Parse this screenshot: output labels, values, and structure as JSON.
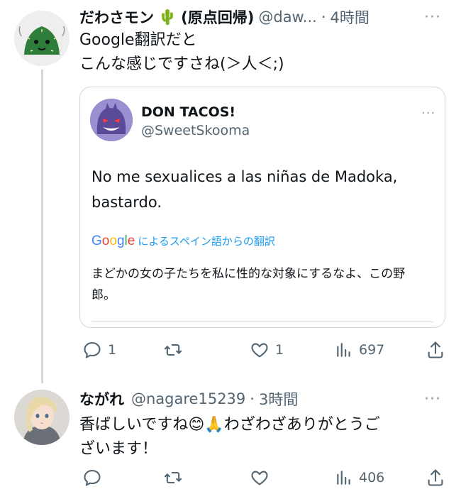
{
  "tweet1": {
    "display_name": "だわさモン",
    "name_emoji": "🌵",
    "name_suffix": "(原点回帰)",
    "handle": "@daw...",
    "separator": "·",
    "time": "4時間",
    "text_line1": "Google翻訳だと",
    "text_line2": "こんな感じですさね(＞人＜;)",
    "actions": {
      "replies": "1",
      "likes": "1",
      "views": "697"
    }
  },
  "quote": {
    "display_name": "DON TACOS!",
    "handle": "@SweetSkooma",
    "text_line1": "No me sexualices a las niñas de Madoka,",
    "text_line2": "bastardo.",
    "translation_logo": "Google",
    "translation_label": "によるスペイン語からの翻訳",
    "translation_line1": "まどかの女の子たちを私に性的な対象にするなよ、この野",
    "translation_line2": "郎。"
  },
  "tweet2": {
    "display_name": "ながれ",
    "handle": "@nagare15239",
    "separator": "·",
    "time": "3時間",
    "text_line1_a": "香ばしいですね",
    "emoji1": "😊",
    "emoji2": "🙏",
    "text_line1_b": "わざわざありがとうご",
    "text_line2": "ざいます！",
    "actions": {
      "views": "406"
    }
  },
  "more_glyph": "···",
  "colors": {
    "text": "#0f1419",
    "secondary": "#536471",
    "border": "#cfd9de",
    "google_blue": "#4285F4",
    "google_red": "#EA4335",
    "google_yellow": "#FBBC05",
    "google_green": "#34A853",
    "link_blue": "#1d9bf0"
  }
}
